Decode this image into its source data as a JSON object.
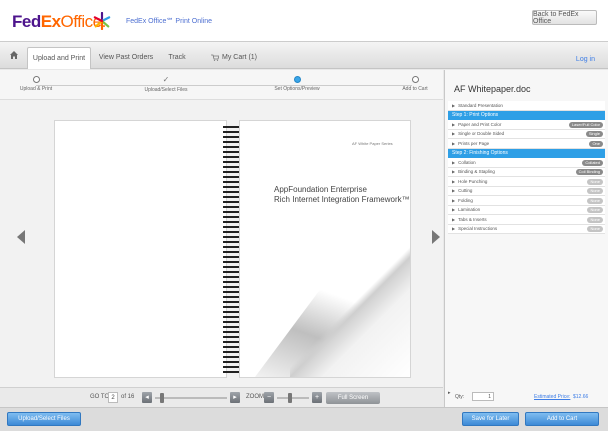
{
  "header": {
    "logo_fed": "Fed",
    "logo_ex": "Ex",
    "logo_office": "Office.",
    "tagline": "FedEx Office℠ Print Online",
    "back_label": "Back to FedEx Office"
  },
  "nav": {
    "tabs": [
      "Upload and Print",
      "View Past Orders",
      "Track",
      "My Cart (1)"
    ],
    "login": "Log in"
  },
  "steps": [
    {
      "label": "Upload & Print",
      "state": "done"
    },
    {
      "label": "Upload/Select Files",
      "state": "done"
    },
    {
      "label": "Set Options/Preview",
      "state": "active"
    },
    {
      "label": "Add to Cart",
      "state": "pending"
    }
  ],
  "document": {
    "series": "AF White Paper Series",
    "title_line1": "AppFoundation Enterprise",
    "title_line2": "Rich Internet Integration Framework™"
  },
  "controls": {
    "goto_label": "GO TO",
    "page_current": "2",
    "page_total": "of 16",
    "zoom_label": "ZOOM",
    "fullscreen_label": "Full Screen"
  },
  "panel": {
    "title": "AF Whitepaper.doc",
    "rows": [
      {
        "label": "Standard Presentation",
        "type": "item",
        "pill": ""
      },
      {
        "label": "Step 1: Print Options",
        "type": "section",
        "pill": ""
      },
      {
        "label": "Paper and Print Color",
        "type": "item",
        "pill": "Laser/Full Color"
      },
      {
        "label": "Single or Double Sided",
        "type": "item",
        "pill": "Single"
      },
      {
        "label": "Prints per Page",
        "type": "item",
        "pill": "One"
      },
      {
        "label": "Step 2: Finishing Options",
        "type": "section",
        "pill": ""
      },
      {
        "label": "Collation",
        "type": "item",
        "pill": "Collated"
      },
      {
        "label": "Binding & Stapling",
        "type": "item",
        "pill": "Coil Binding"
      },
      {
        "label": "Hole Punching",
        "type": "item",
        "pill": "None",
        "light": true
      },
      {
        "label": "Cutting",
        "type": "item",
        "pill": "None",
        "light": true
      },
      {
        "label": "Folding",
        "type": "item",
        "pill": "None",
        "light": true
      },
      {
        "label": "Lamination",
        "type": "item",
        "pill": "None",
        "light": true
      },
      {
        "label": "Tabs & Inserts",
        "type": "item",
        "pill": "None",
        "light": true
      },
      {
        "label": "Special Instructions",
        "type": "item",
        "pill": "None",
        "light": true
      }
    ],
    "qty_label": "Qty:",
    "qty_value": "1",
    "estimated_label": "Estimated Price:",
    "price": "$12.66"
  },
  "bottom": {
    "upload_label": "Upload/Select Files",
    "save_label": "Save for Later",
    "add_label": "Add to Cart"
  },
  "colors": {
    "fedex_purple": "#4d148c",
    "fedex_orange": "#ff6600",
    "accent_blue": "#2e9fe6"
  }
}
